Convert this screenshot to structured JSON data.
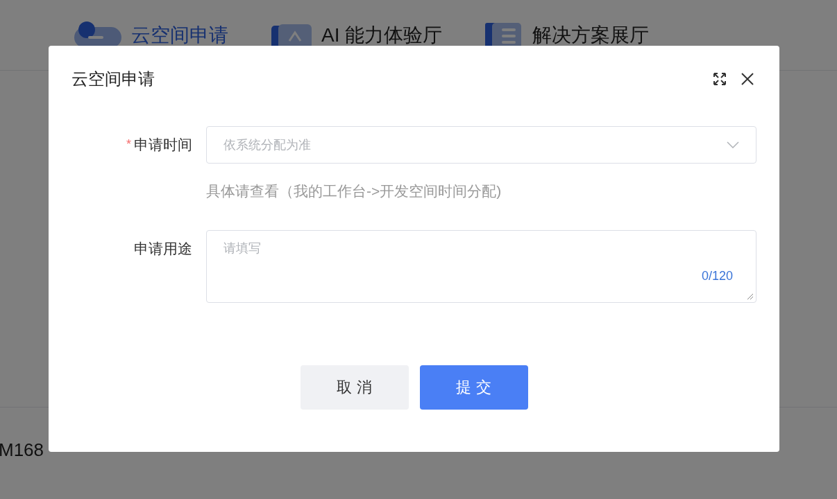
{
  "nav": {
    "items": [
      {
        "label": "云空间申请",
        "selected": true
      },
      {
        "label": "AI 能力体验厅",
        "selected": false
      },
      {
        "label": "解决方案展厅",
        "selected": false
      }
    ]
  },
  "page": {
    "description": "M168"
  },
  "dialog": {
    "title": "云空间申请",
    "fields": [
      {
        "kind": "select",
        "label": "申请时间",
        "required_mark": "*",
        "placeholder": "依系统分配为准",
        "hint": "具体请查看（我的工作台->开发空间时间分配)"
      },
      {
        "kind": "textarea",
        "label": "申请用途",
        "placeholder": "请填写",
        "counter": "0/120"
      }
    ],
    "buttons": [
      {
        "label": "取 消",
        "kind": "secondary"
      },
      {
        "label": "提 交",
        "kind": "primary"
      }
    ]
  }
}
